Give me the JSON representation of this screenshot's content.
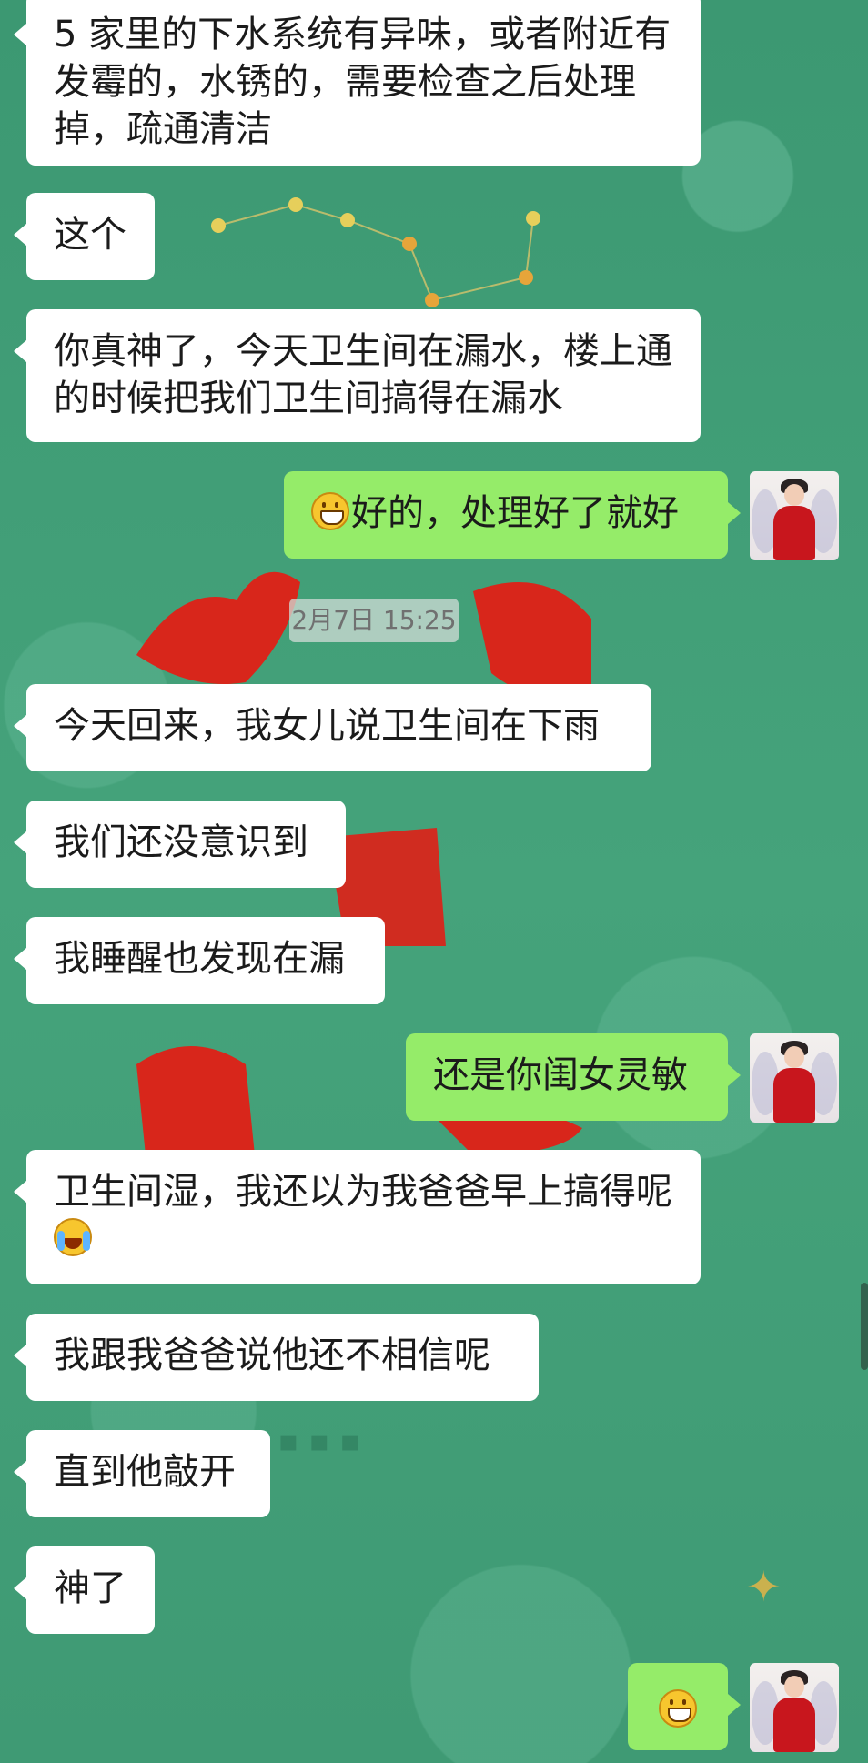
{
  "chat": {
    "timestamp": "2月7日 15:25",
    "messages": [
      {
        "side": "left",
        "text": "5 家里的下水系统有异味，或者附近有发霉的，水锈的，需要检查之后处理掉，疏通清洁"
      },
      {
        "side": "left",
        "text": "这个"
      },
      {
        "side": "left",
        "text": "你真神了，今天卫生间在漏水，楼上通的时候把我们卫生间搞得在漏水"
      },
      {
        "side": "right",
        "emoji": "grin-emoji",
        "text": "好的，处理好了就好"
      },
      {
        "side": "left",
        "text": "今天回来，我女儿说卫生间在下雨"
      },
      {
        "side": "left",
        "text": "我们还没意识到"
      },
      {
        "side": "left",
        "text": "我睡醒也发现在漏"
      },
      {
        "side": "right",
        "text": "还是你闺女灵敏"
      },
      {
        "side": "left",
        "text": "卫生间湿，我还以为我爸爸早上搞得呢",
        "emoji": "cry-emoji"
      },
      {
        "side": "left",
        "text": "我跟我爸爸说他还不相信呢"
      },
      {
        "side": "left",
        "text": "直到他敲开"
      },
      {
        "side": "left",
        "text": "神了"
      },
      {
        "side": "right",
        "emoji": "grin-emoji",
        "text": ""
      }
    ]
  }
}
